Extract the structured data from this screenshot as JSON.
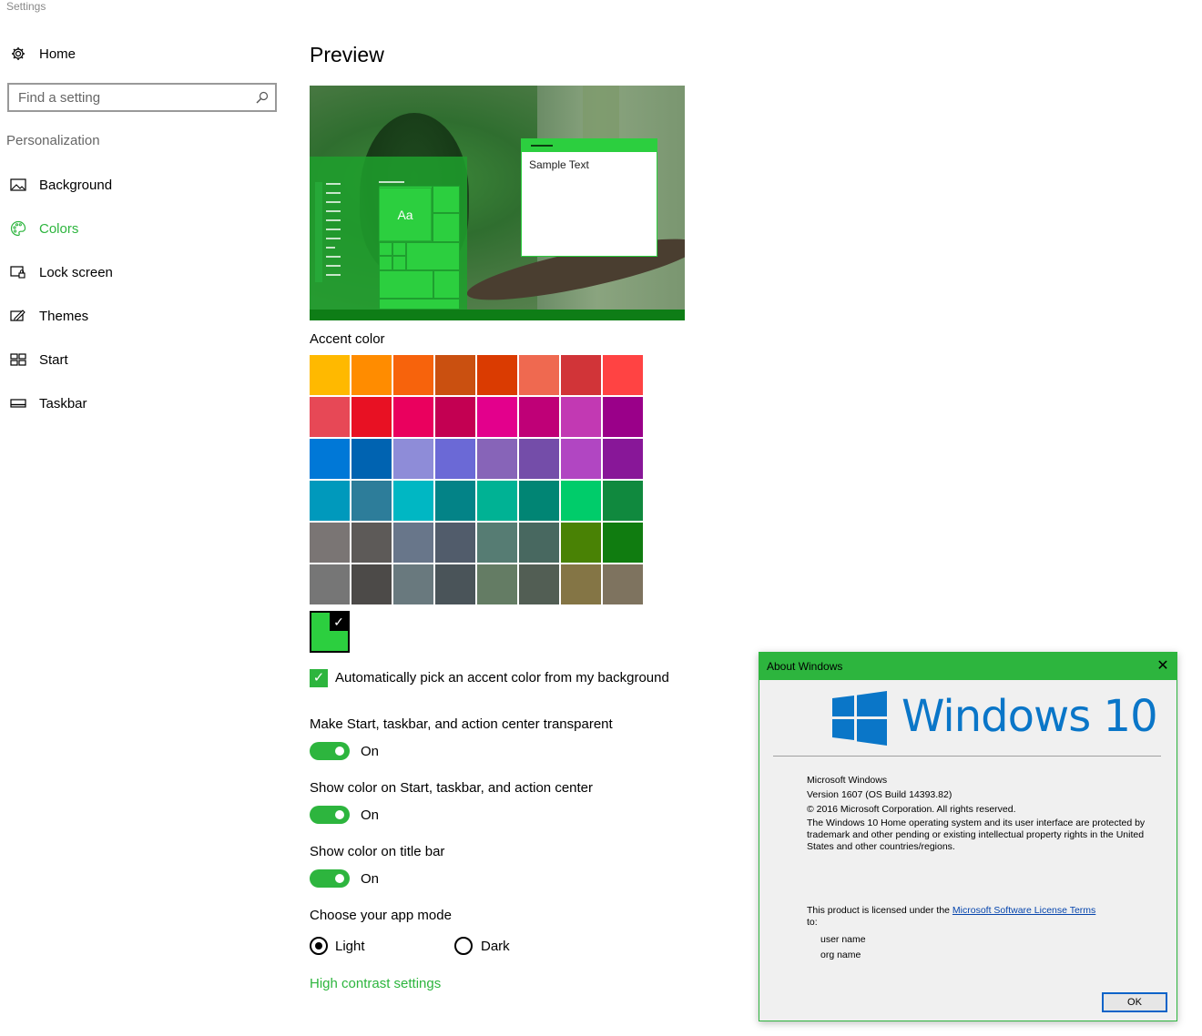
{
  "window": {
    "title": "Settings"
  },
  "sidebar": {
    "home_label": "Home",
    "search_placeholder": "Find a setting",
    "section": "Personalization",
    "items": [
      {
        "label": "Background",
        "icon": "picture-icon"
      },
      {
        "label": "Colors",
        "icon": "palette-icon",
        "active": true
      },
      {
        "label": "Lock screen",
        "icon": "lock-screen-icon"
      },
      {
        "label": "Themes",
        "icon": "themes-icon"
      },
      {
        "label": "Start",
        "icon": "start-icon"
      },
      {
        "label": "Taskbar",
        "icon": "taskbar-icon"
      }
    ]
  },
  "main": {
    "preview_heading": "Preview",
    "preview": {
      "tile_label": "Aa",
      "sample_text": "Sample Text"
    },
    "accent_heading": "Accent color",
    "accent_colors": [
      "#FFB900",
      "#FF8C00",
      "#F7630C",
      "#CA5010",
      "#DA3B01",
      "#EF6950",
      "#D13438",
      "#FF4343",
      "#E74856",
      "#E81123",
      "#EA005E",
      "#C30052",
      "#E3008C",
      "#BF0077",
      "#C239B3",
      "#9A0089",
      "#0078D7",
      "#0063B1",
      "#8E8CD8",
      "#6B69D6",
      "#8764B8",
      "#744DA9",
      "#B146C2",
      "#881798",
      "#0099BC",
      "#2D7D9A",
      "#00B7C3",
      "#038387",
      "#00B294",
      "#018574",
      "#00CC6A",
      "#10893E",
      "#7A7574",
      "#5D5A58",
      "#68768A",
      "#515C6B",
      "#567C73",
      "#486860",
      "#498205",
      "#107C10",
      "#767676",
      "#4C4A48",
      "#69797E",
      "#4A5459",
      "#647C64",
      "#525E54",
      "#847545",
      "#7E735F"
    ],
    "current_accent": "#2CCF3F",
    "auto_pick_label": "Automatically pick an accent color from my background",
    "transparent_label": "Make Start, taskbar, and action center transparent",
    "transparent_state": "On",
    "show_color_start_label": "Show color on Start, taskbar, and action center",
    "show_color_start_state": "On",
    "show_color_title_label": "Show color on title bar",
    "show_color_title_state": "On",
    "app_mode_label": "Choose your app mode",
    "light_label": "Light",
    "dark_label": "Dark",
    "high_contrast_link": "High contrast settings"
  },
  "about": {
    "title": "About Windows",
    "brand": "Windows 10",
    "line1": "Microsoft Windows",
    "line2": "Version 1607 (OS Build 14393.82)",
    "line3": "© 2016 Microsoft Corporation. All rights reserved.",
    "para": "The Windows 10 Home operating system and its user interface are protected by trademark and other pending or existing intellectual property rights in the United States and other countries/regions.",
    "license_prefix": "This product is licensed under the ",
    "license_link": "Microsoft Software License Terms",
    "license_suffix": " to:",
    "user_name": "user name",
    "org_name": "org name",
    "ok_label": "OK"
  },
  "colors": {
    "accent": "#2db53e",
    "link": "#0645ad",
    "brand_blue": "#0a76c8"
  }
}
